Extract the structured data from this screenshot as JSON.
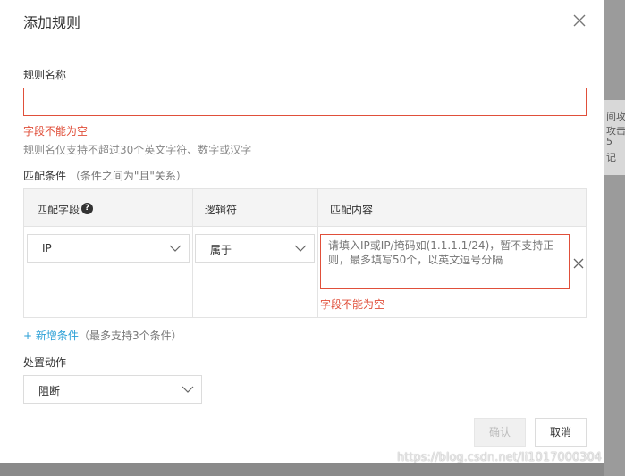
{
  "dialog": {
    "title": "添加规则"
  },
  "rule_name": {
    "label": "规则名称",
    "value": "",
    "error": "字段不能为空",
    "help": "规则名仅支持不超过30个英文字符、数字或汉字"
  },
  "conditions": {
    "label": "匹配条件",
    "note": "（条件之间为\"且\"关系）",
    "headers": [
      "匹配字段",
      "逻辑符",
      "匹配内容"
    ],
    "row": {
      "field": "IP",
      "operator": "属于",
      "content_value": "",
      "content_placeholder": "请填入IP或IP/掩码如(1.1.1.1/24)，暂不支持正则，最多填写50个，以英文逗号分隔",
      "content_error": "字段不能为空"
    },
    "add_label": "+ 新增条件",
    "add_hint": "（最多支持3个条件）"
  },
  "action": {
    "label": "处置动作",
    "value": "阻断"
  },
  "buttons": {
    "confirm": "确认",
    "cancel": "取消"
  },
  "background": {
    "lines": [
      "间攻",
      "攻击",
      "5",
      "记"
    ]
  },
  "watermark": "https://blog.csdn.net/li1017000304",
  "colors": {
    "error": "#e04f3a",
    "link": "#2a9fd6"
  }
}
